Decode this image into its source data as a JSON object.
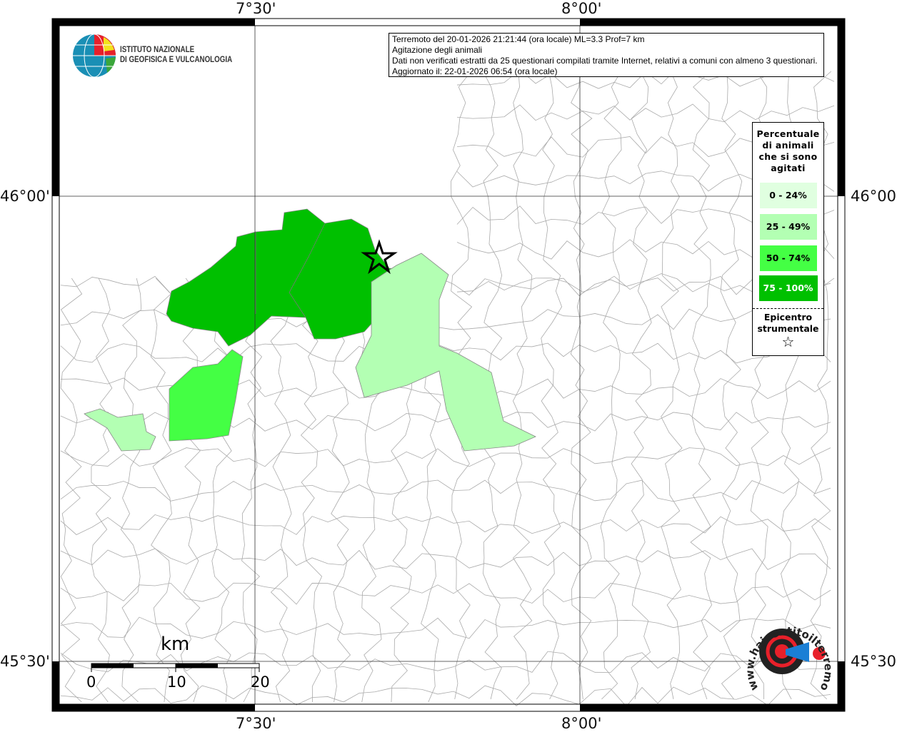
{
  "info": {
    "line1": "Terremoto del 20-01-2026 21:21:44 (ora locale) ML=3.3 Prof=7 km",
    "line2": "Agitazione degli animali",
    "line3": "Dati non verificati estratti da 25 questionari compilati tramite Internet, relativi a comuni con almeno 3 questionari.",
    "line4": "Aggiornato il: 22-01-2026 06:54 (ora locale)"
  },
  "logo_ingv": {
    "line1": "ISTITUTO NAZIONALE",
    "line2": "DI GEOFISICA E VULCANOLOGIA"
  },
  "logo_hsit": {
    "text": "www.haisentitoilterremoto.it"
  },
  "axes": {
    "lon_ticks": [
      "7°30'",
      "8°00'"
    ],
    "lat_ticks": [
      "46°00'",
      "45°30'"
    ]
  },
  "legend": {
    "title": [
      "Percentuale",
      "di animali",
      "che si sono",
      "agitati"
    ],
    "classes": [
      {
        "label": "0 - 24%",
        "color": "#e0ffe0"
      },
      {
        "label": "25 - 49%",
        "color": "#b3ffb3"
      },
      {
        "label": "50 - 74%",
        "color": "#44ff44"
      },
      {
        "label": "75 - 100%",
        "color": "#00c000"
      }
    ],
    "epicenter_label": [
      "Epicentro",
      "strumentale"
    ],
    "epicenter_symbol": "☆"
  },
  "scale": {
    "unit": "km",
    "labels": [
      "0",
      "10",
      "20"
    ]
  },
  "map": {
    "regions": [
      {
        "class": "75 - 100%",
        "color": "#00c000"
      },
      {
        "class": "25 - 49%",
        "color": "#b3ffb3"
      },
      {
        "class": "50 - 74%",
        "color": "#44ff44"
      },
      {
        "class": "25 - 49%",
        "color": "#b3ffb3"
      }
    ]
  }
}
